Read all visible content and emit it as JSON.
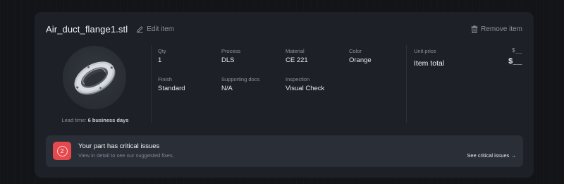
{
  "item": {
    "file_name": "Air_duct_flange1.stl",
    "edit_label": "Edit item",
    "remove_label": "Remove item",
    "lead_time_prefix": "Lead time:",
    "lead_time_value": "6 business days"
  },
  "specs": {
    "qty": {
      "label": "Qty",
      "value": "1"
    },
    "process": {
      "label": "Process",
      "value": "DLS"
    },
    "material": {
      "label": "Material",
      "value": "CE 221"
    },
    "color": {
      "label": "Color",
      "value": "Orange"
    },
    "finish": {
      "label": "Finish",
      "value": "Standard"
    },
    "supporting_docs": {
      "label": "Supporting docs",
      "value": "N/A"
    },
    "inspection": {
      "label": "Inspection",
      "value": "Visual Check"
    }
  },
  "pricing": {
    "unit_price_label": "Unit price",
    "unit_price_value": "$__",
    "item_total_label": "Item total",
    "item_total_value": "$__"
  },
  "issues": {
    "count": "2",
    "title": "Your part has critical issues",
    "subtitle": "View in detail to see our suggested fixes.",
    "link": "See critical issues →"
  },
  "icons": {
    "edit": "pencil-icon",
    "remove": "trash-icon",
    "issue": "warning-count-icon"
  },
  "colors": {
    "card_bg": "#1d2127",
    "page_bg": "#121418",
    "issue_accent": "#e5484d"
  }
}
